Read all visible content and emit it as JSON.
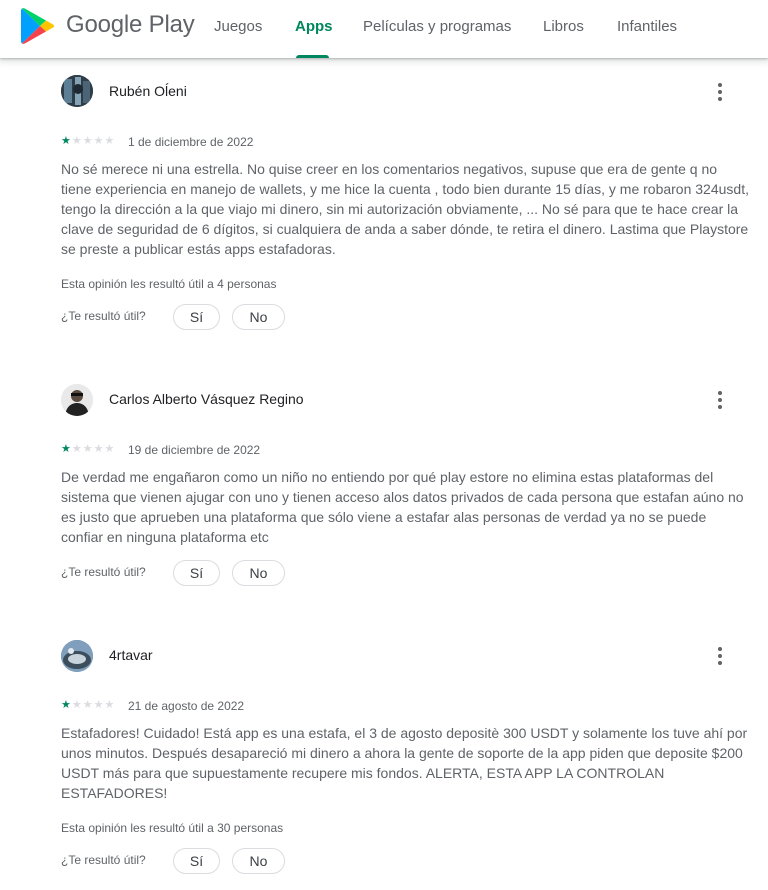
{
  "header": {
    "brand": "Google Play",
    "nav": [
      {
        "label": "Juegos"
      },
      {
        "label": "Apps",
        "active": true
      },
      {
        "label": "Películas y programas"
      },
      {
        "label": "Libros"
      },
      {
        "label": "Infantiles"
      }
    ],
    "accent_color": "#01875f"
  },
  "question_label": "¿Te resultó útil?",
  "yes_label": "Sí",
  "no_label": "No",
  "reviews": [
    {
      "author": "Rubén Oĺeni",
      "rating": 1,
      "max_rating": 5,
      "date": "1 de diciembre de 2022",
      "text": "No sé merece ni una estrella. No quise creer en los comentarios negativos, supuse que era de gente q no tiene experiencia en manejo de wallets, y me hice la cuenta , todo bien durante 15 días, y me robaron 324usdt, tengo la dirección a la que viajo mi dinero, sin mi autorización obviamente, ... No sé para que te hace crear la clave de seguridad de 6 dígitos, si cualquiera de anda a saber dónde, te retira el dinero. Lastima que Playstore se preste a publicar estás apps estafadoras.",
      "helpful": "Esta opinión les resultó útil a 4 personas"
    },
    {
      "author": "Carlos Alberto Vásquez Regino",
      "rating": 1,
      "max_rating": 5,
      "date": "19 de diciembre de 2022",
      "text": "De verdad me engañaron como un niño no entiendo por qué play estore no elimina estas plataformas del sistema que vienen ajugar con uno y tienen acceso alos datos privados de cada persona que estafan aúno no es justo que aprueben una plataforma que sólo viene a estafar alas personas de verdad ya no se puede confiar en ninguna plataforma etc",
      "helpful": ""
    },
    {
      "author": "4rtavar",
      "rating": 1,
      "max_rating": 5,
      "date": "21 de agosto de 2022",
      "text": "Estafadores! Cuidado! Está app es una estafa, el 3 de agosto depositè 300 USDT y solamente los tuve ahí por unos minutos. Después desapareció mi dinero a ahora la gente de soporte de la app piden que deposite $200 USDT más para que supuestamente recupere mis fondos. ALERTA, ESTA APP LA CONTROLAN ESTAFADORES!",
      "helpful": "Esta opinión les resultó útil a 30 personas"
    }
  ]
}
